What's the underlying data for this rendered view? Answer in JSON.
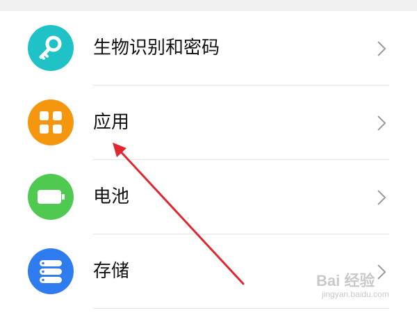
{
  "settings_list": {
    "items": [
      {
        "id": "biometrics",
        "label": "生物识别和密码",
        "icon": "key-icon",
        "icon_color": "#1fc2c6"
      },
      {
        "id": "apps",
        "label": "应用",
        "icon": "apps-grid-icon",
        "icon_color": "#f5960f"
      },
      {
        "id": "battery",
        "label": "电池",
        "icon": "battery-icon",
        "icon_color": "#4fc94f"
      },
      {
        "id": "storage",
        "label": "存储",
        "icon": "storage-icon",
        "icon_color": "#2f7bf0"
      }
    ]
  },
  "annotation": {
    "arrow_color": "#e0272f",
    "points_to": "apps"
  },
  "watermark": {
    "main": "Bai 经验",
    "sub": "jingyan.baidu.com"
  }
}
